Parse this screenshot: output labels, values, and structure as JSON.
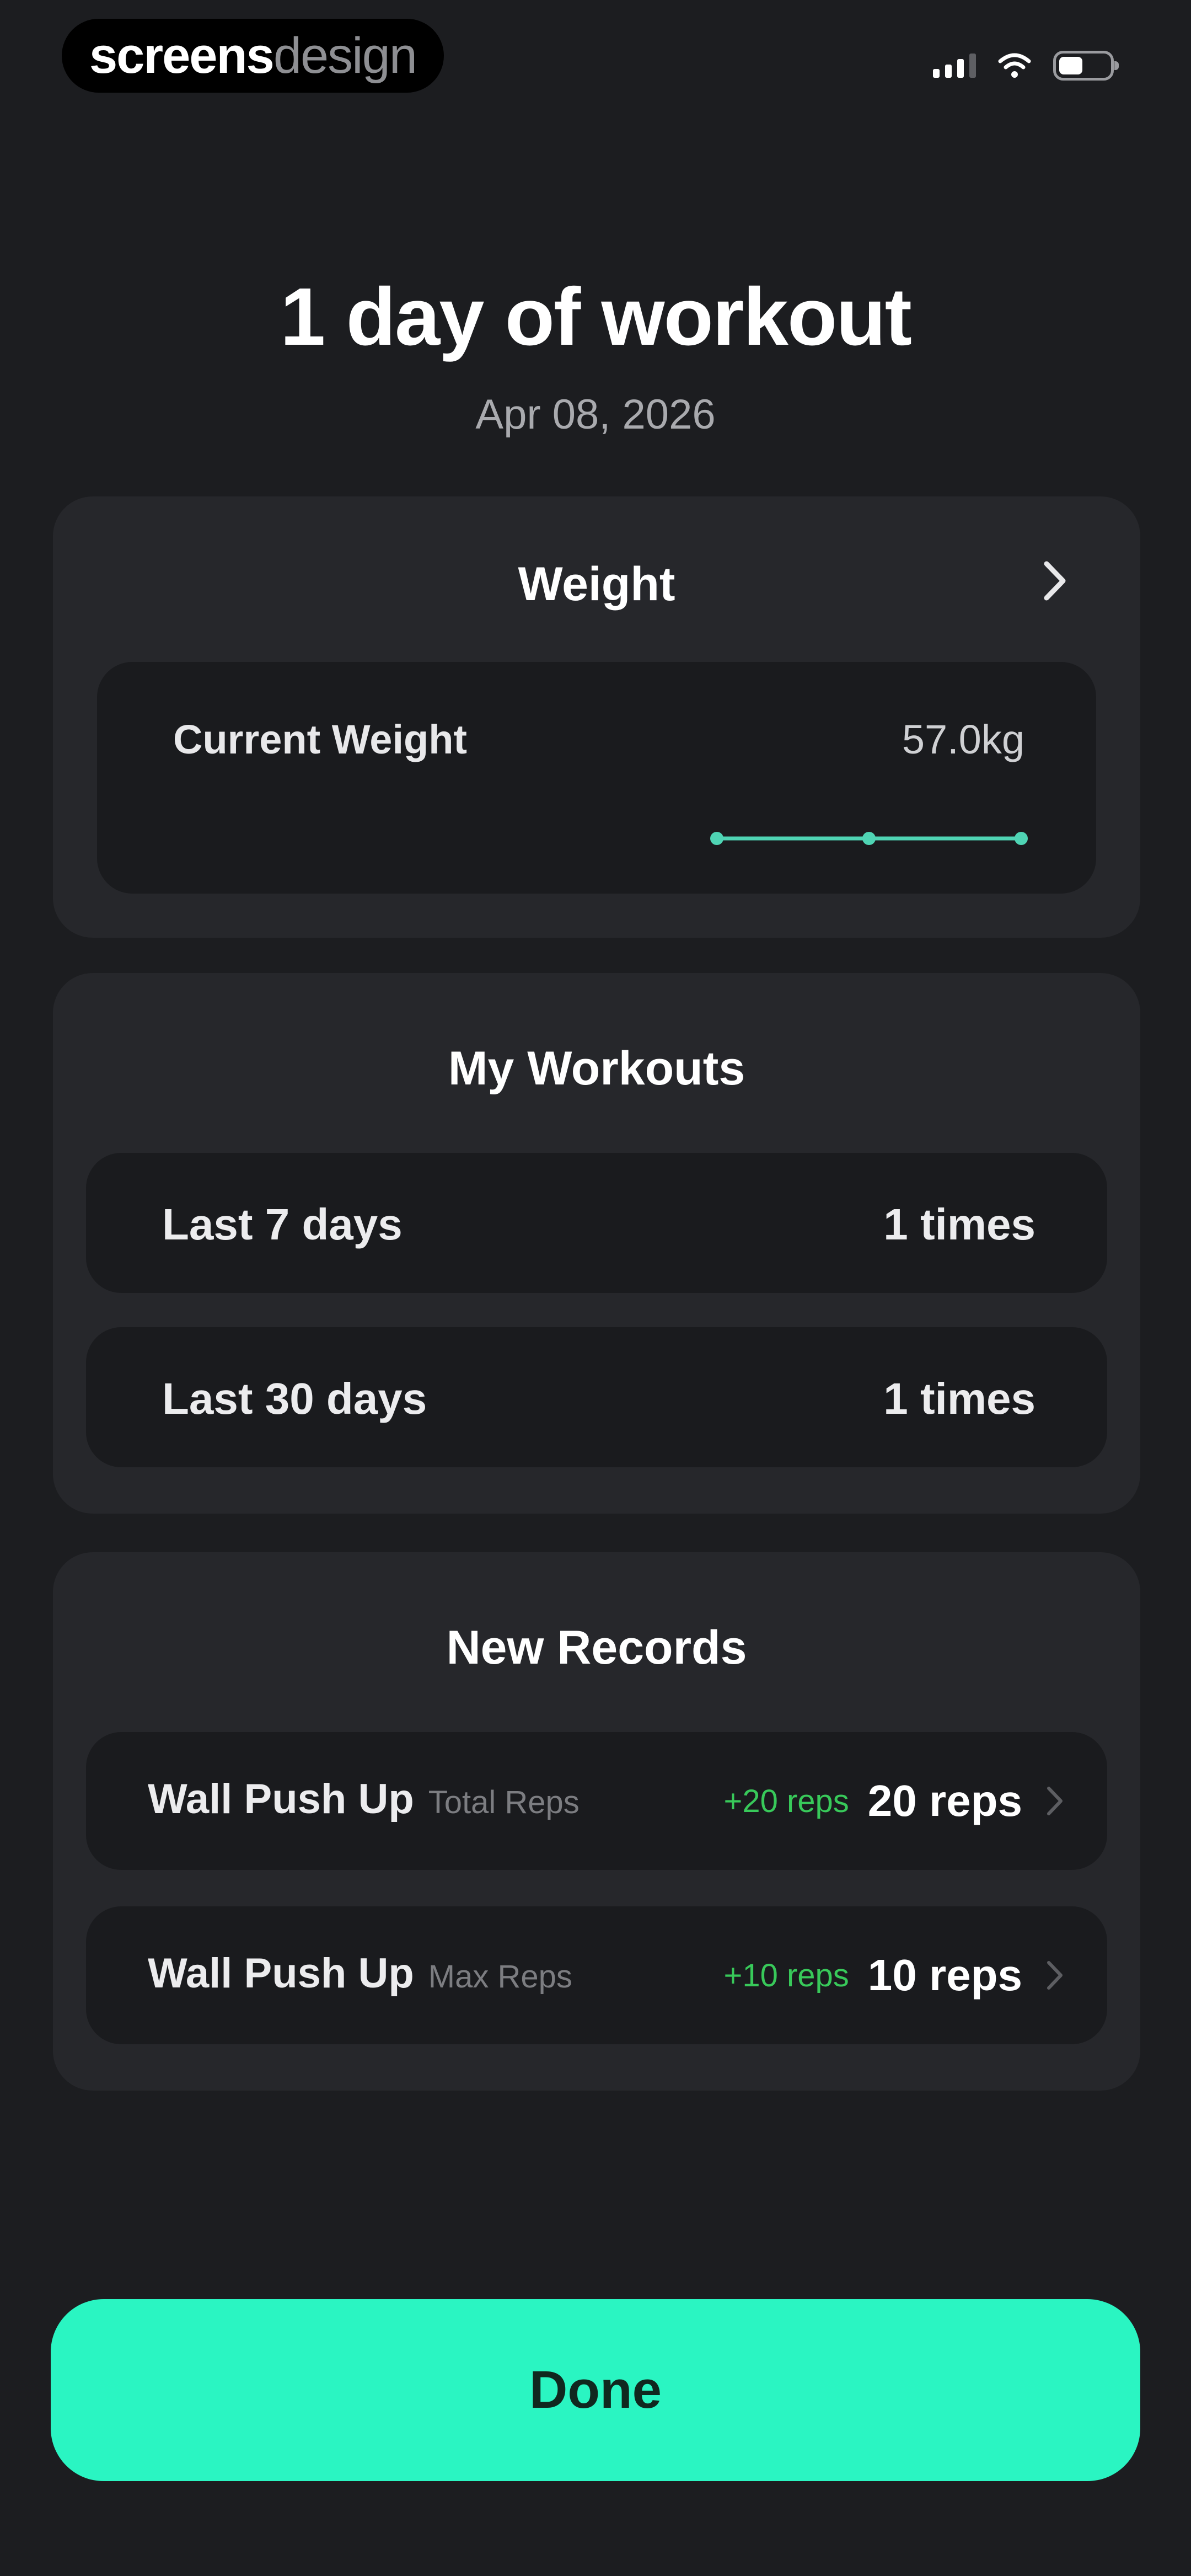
{
  "status_bar": {
    "brand_primary": "screens",
    "brand_secondary": "design",
    "icons": [
      "cellular-signal-icon",
      "wifi-icon",
      "battery-icon"
    ]
  },
  "header": {
    "title": "1 day of workout",
    "date": "Apr 08, 2026"
  },
  "weight": {
    "title": "Weight",
    "current_label": "Current Weight",
    "current_value": "57.0kg",
    "trend_points": [
      57.0,
      57.0,
      57.0
    ],
    "trend_color": "#4fd4b4"
  },
  "workouts": {
    "title": "My Workouts",
    "rows": [
      {
        "label": "Last 7 days",
        "value": "1 times"
      },
      {
        "label": "Last 30 days",
        "value": "1 times"
      }
    ]
  },
  "records": {
    "title": "New Records",
    "items": [
      {
        "exercise": "Wall Push Up",
        "metric": "Total Reps",
        "delta": "+20 reps",
        "value": "20 reps"
      },
      {
        "exercise": "Wall Push Up",
        "metric": "Max Reps",
        "delta": "+10 reps",
        "value": "10 reps"
      }
    ]
  },
  "done_button": {
    "label": "Done",
    "color": "#2af5c2"
  },
  "colors": {
    "background": "#1c1d20",
    "card": "#26272b",
    "inner": "#1a1b1e",
    "positive_delta": "#38c95a"
  }
}
